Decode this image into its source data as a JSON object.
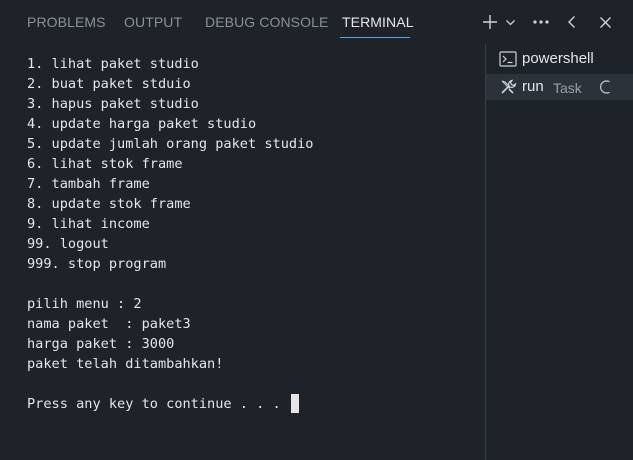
{
  "tabs": [
    {
      "label": "PROBLEMS",
      "active": false
    },
    {
      "label": "OUTPUT",
      "active": false
    },
    {
      "label": "DEBUG CONSOLE",
      "active": false
    },
    {
      "label": "TERMINAL",
      "active": true
    }
  ],
  "toolbar": {
    "icons": [
      "plus-icon",
      "chevron-down-icon",
      "more-icon",
      "chevron-left-icon",
      "close-icon"
    ]
  },
  "terminal": {
    "lines": [
      "1. lihat paket studio",
      "2. buat paket stduio",
      "3. hapus paket studio",
      "4. update harga paket studio",
      "5. update jumlah orang paket studio",
      "6. lihat stok frame",
      "7. tambah frame",
      "8. update stok frame",
      "9. lihat income",
      "99. logout",
      "999. stop program",
      "",
      "pilih menu : 2",
      "nama paket  : paket3",
      "harga paket : 3000",
      "paket telah ditambahkan!",
      "",
      "Press any key to continue . . . "
    ]
  },
  "sessions": [
    {
      "label": "powershell",
      "sub": "",
      "icon": "terminal-icon",
      "active": false
    },
    {
      "label": "run",
      "sub": "Task",
      "icon": "tools-icon",
      "active": true
    }
  ],
  "colors": {
    "background": "#1e2329",
    "active_tab_underline": "#5aa0e6",
    "session_active_bg": "#2c323a"
  }
}
